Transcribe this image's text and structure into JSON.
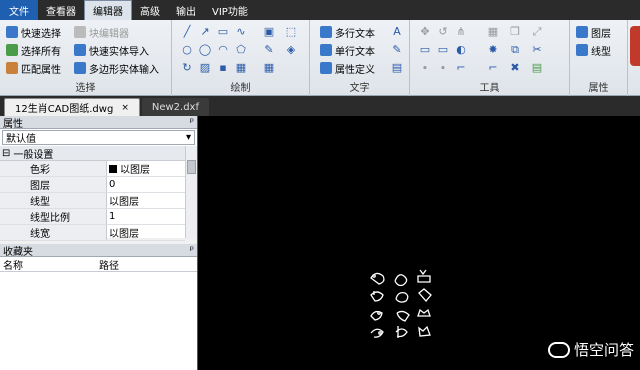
{
  "menubar": {
    "items": [
      {
        "label": "文件"
      },
      {
        "label": "查看器"
      },
      {
        "label": "编辑器"
      },
      {
        "label": "高级"
      },
      {
        "label": "输出"
      },
      {
        "label": "VIP功能"
      }
    ],
    "active_index": 2
  },
  "ribbon": {
    "select_group": {
      "label": "选择",
      "buttons": [
        "快速选择",
        "选择所有",
        "匹配属性",
        "块编辑器",
        "快速实体导入",
        "多边形实体输入"
      ]
    },
    "draw_group": {
      "label": "绘制"
    },
    "text_group": {
      "label": "文字",
      "buttons": [
        "多行文本",
        "单行文本",
        "属性定义"
      ]
    },
    "tools_group": {
      "label": "工具"
    },
    "props_group": {
      "label": "属性",
      "buttons": [
        "图层",
        "线型"
      ]
    }
  },
  "tabs": [
    {
      "label": "12生肖CAD图纸.dwg",
      "close": "×"
    },
    {
      "label": "New2.dxf"
    }
  ],
  "properties": {
    "title": "属性",
    "pin": "ᵖ",
    "dropdown_value": "默认值",
    "dropdown_arrow": "▾",
    "section": "一般设置",
    "section_toggle": "⊟",
    "rows": [
      {
        "name": "色彩",
        "value": "以图层",
        "swatch": true
      },
      {
        "name": "图层",
        "value": "0"
      },
      {
        "name": "线型",
        "value": "以图层"
      },
      {
        "name": "线型比例",
        "value": "1"
      },
      {
        "name": "线宽",
        "value": "以图层"
      }
    ]
  },
  "favorites": {
    "title": "收藏夹",
    "pin": "ᵖ",
    "columns": [
      "名称",
      "路径"
    ]
  },
  "canvas": {
    "background": "#000000"
  },
  "watermark": {
    "text": "悟空问答"
  }
}
